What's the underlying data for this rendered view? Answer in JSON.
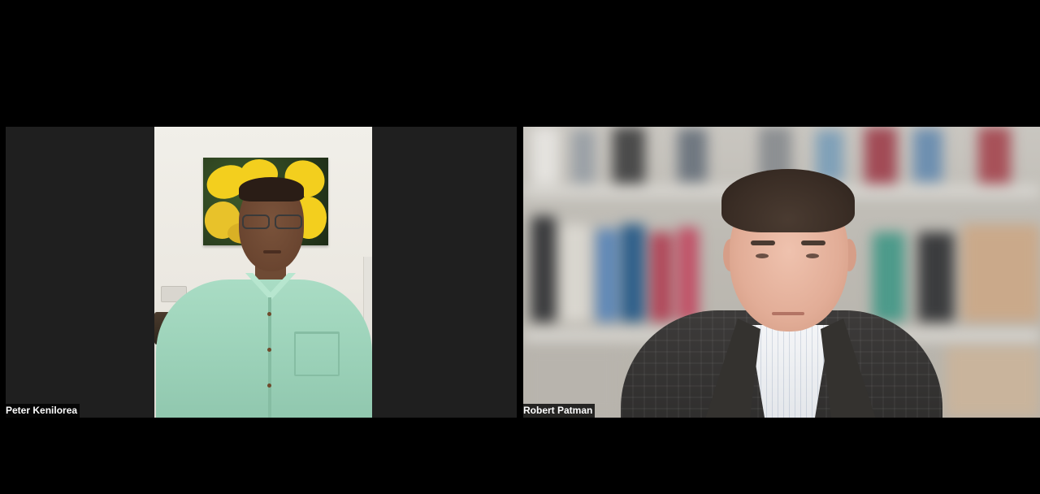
{
  "meeting": {
    "participants": [
      {
        "name": "Peter Kenilorea"
      },
      {
        "name": "Robert Patman"
      }
    ]
  },
  "colors": {
    "background": "#000000",
    "tile_background": "#1f1f1f",
    "name_label_background": "#000000",
    "name_label_text": "#ffffff"
  }
}
